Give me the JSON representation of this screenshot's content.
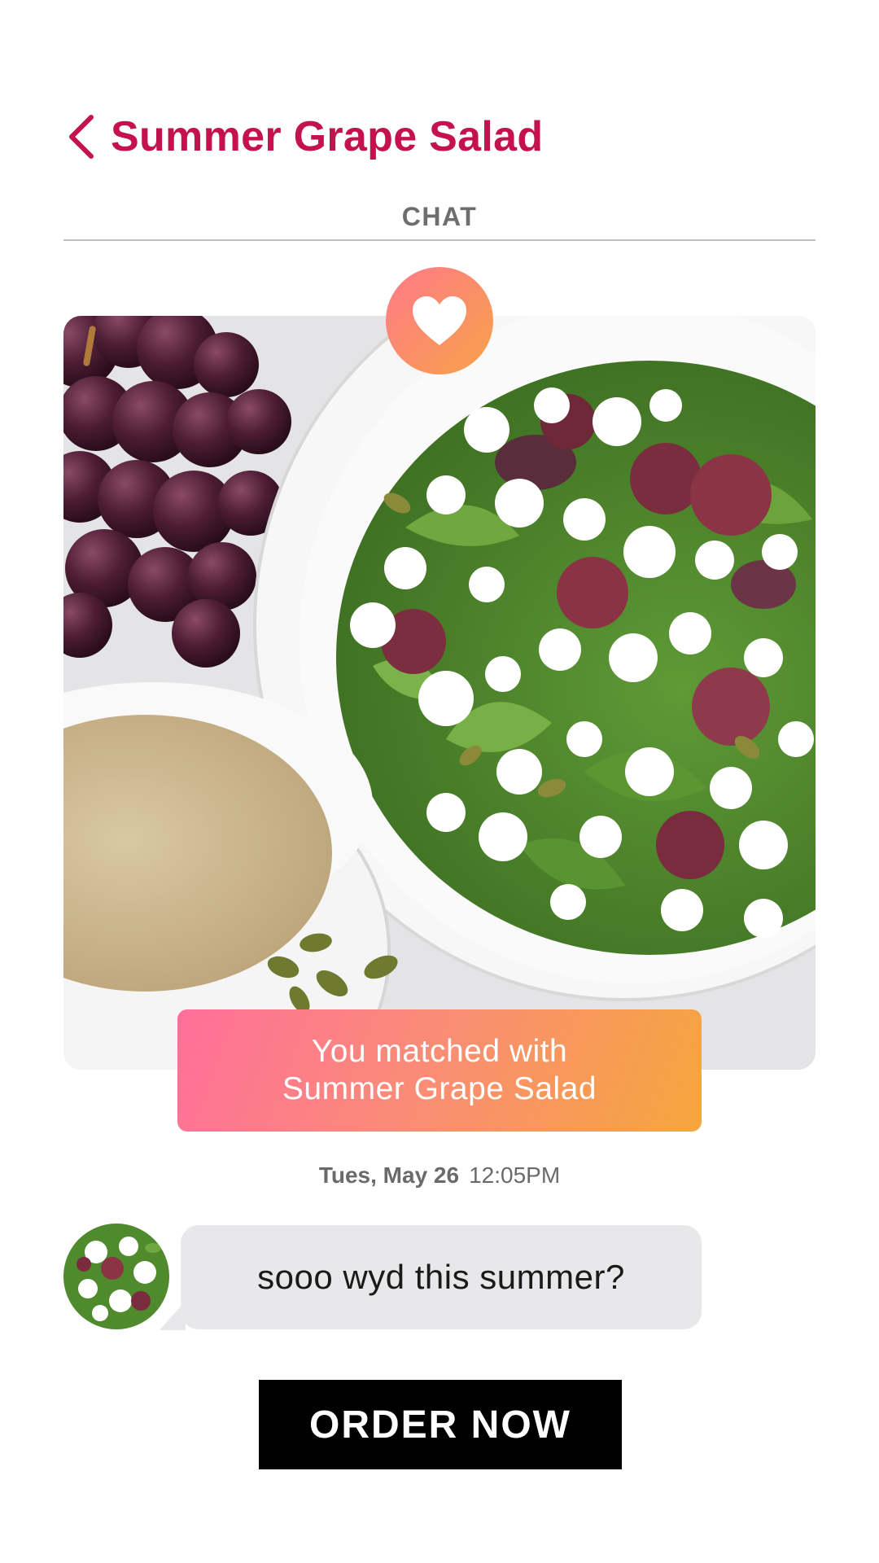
{
  "header": {
    "back_icon": "chevron-left-icon",
    "title": "Summer Grape Salad"
  },
  "tabs": {
    "active_label": "CHAT"
  },
  "hero": {
    "badge_icon": "heart-icon",
    "image_subject": "grape-salad-photo"
  },
  "match": {
    "line1": "You matched with",
    "line2": "Summer Grape Salad"
  },
  "chat": {
    "date": "Tues, May 26",
    "time": "12:05PM",
    "avatar": "salad-avatar",
    "message": "sooo wyd this summer?"
  },
  "cta": {
    "label": "ORDER NOW"
  },
  "colors": {
    "title": "#c4124f",
    "gradient_start": "#ff6f9a",
    "gradient_end": "#f6a63d",
    "bubble_bg": "#e8e8ea",
    "button_bg": "#000000"
  }
}
